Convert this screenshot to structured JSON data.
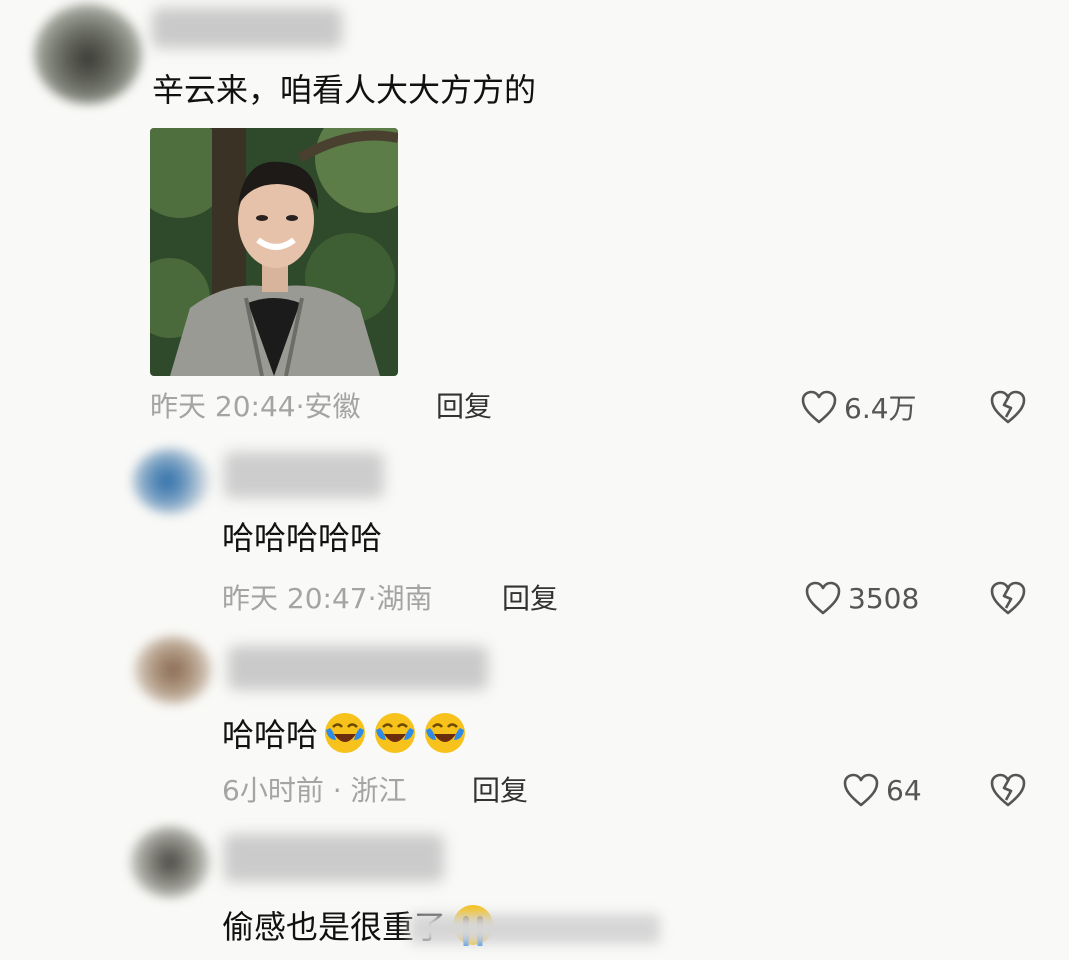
{
  "comments": [
    {
      "text": "辛云来，咱看人大大方方的",
      "time": "昨天 20:44",
      "location": "安徽",
      "reply_label": "回复",
      "likes": "6.4万"
    },
    {
      "text": "哈哈哈哈哈",
      "time": "昨天 20:47",
      "location": "湖南",
      "reply_label": "回复",
      "likes": "3508"
    },
    {
      "text": "哈哈哈",
      "emoji": "laughing-crying-emoji",
      "time": "6小时前",
      "location": "浙江",
      "reply_label": "回复",
      "likes": "64"
    },
    {
      "text": "偷感也是很重了",
      "emoji": "crying-emoji"
    }
  ],
  "icons": {
    "like": "heart-outline-icon",
    "dislike": "broken-heart-icon"
  },
  "colors": {
    "background": "#f9f9f7",
    "meta_text": "#a4a4a4",
    "emoji_yellow": "#f6c21b",
    "emoji_tear": "#2f8be8"
  }
}
